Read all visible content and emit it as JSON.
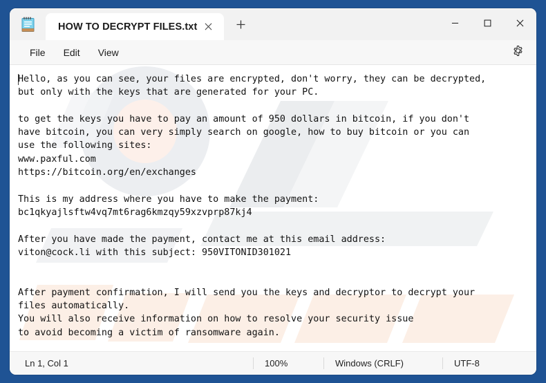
{
  "window": {
    "app_icon": "notepad-icon",
    "controls": {
      "minimize": "minimize-icon",
      "maximize": "maximize-icon",
      "close": "close-icon"
    }
  },
  "tabs": [
    {
      "title": "HOW TO DECRYPT FILES.txt",
      "close_icon": "close-icon",
      "active": true
    }
  ],
  "new_tab_label": "+",
  "menubar": {
    "items": [
      {
        "label": "File"
      },
      {
        "label": "Edit"
      },
      {
        "label": "View"
      }
    ],
    "settings_icon": "gear-icon"
  },
  "document": {
    "content": "Hello, as you can see, your files are encrypted, don't worry, they can be decrypted,\nbut only with the keys that are generated for your PC.\n\nto get the keys you have to pay an amount of 950 dollars in bitcoin, if you don't\nhave bitcoin, you can very simply search on google, how to buy bitcoin or you can\nuse the following sites:\nwww.paxful.com\nhttps://bitcoin.org/en/exchanges\n\nThis is my address where you have to make the payment:\nbc1qkyajlsftw4vq7mt6rag6kmzqy59xzvprp87kj4\n\nAfter you have made the payment, contact me at this email address:\nviton@cock.li with this subject: 950VITONID301021\n\n\nAfter payment confirmation, I will send you the keys and decryptor to decrypt your\nfiles automatically.\nYou will also receive information on how to resolve your security issue\nto avoid becoming a victim of ransomware again.",
    "ransom_amount": "950 dollars",
    "bitcoin_address": "bc1qkyajlsftw4vq7mt6rag6kmzqy59xzvprp87kj4",
    "email": "viton@cock.li",
    "email_subject": "950VITONID301021",
    "sites": [
      "www.paxful.com",
      "https://bitcoin.org/en/exchanges"
    ]
  },
  "statusbar": {
    "position": "Ln 1, Col 1",
    "zoom": "100%",
    "line_ending": "Windows (CRLF)",
    "encoding": "UTF-8"
  },
  "colors": {
    "desktop": "#1f5394",
    "window": "#f7f7f7",
    "titlebar": "#f2f2f2",
    "tab_active": "#ffffff",
    "editor": "#ffffff",
    "text": "#121212"
  }
}
